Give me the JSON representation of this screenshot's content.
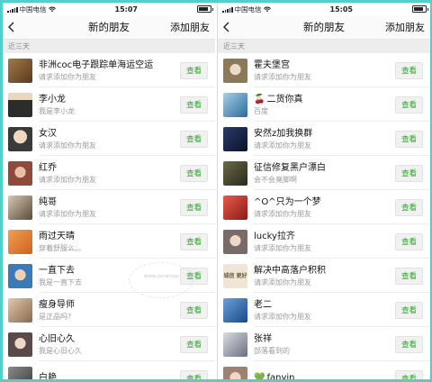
{
  "left": {
    "status": {
      "carrier": "中国电信",
      "time": "15:07"
    },
    "nav": {
      "title": "新的朋友",
      "action": "添加朋友"
    },
    "section": "近三天",
    "rows": [
      {
        "name": "非洲coc电子跟踪单海运空运",
        "msg": "请求添加你为朋友",
        "button": "查看",
        "color": "#7a5a3a"
      },
      {
        "name": "李小龙",
        "msg": "我是李小龙",
        "button": "查看",
        "color": "#2c2c2c"
      },
      {
        "name": "女汉",
        "msg": "请求添加你为朋友",
        "button": "查看",
        "color": "#c9b7a5"
      },
      {
        "name": "红乔",
        "msg": "请求添加你为朋友",
        "button": "查看",
        "color": "#8e5a4a"
      },
      {
        "name": "纯哥",
        "msg": "请求添加你为朋友",
        "button": "查看",
        "color": "#5a4a3a"
      },
      {
        "name": "雨过天晴",
        "msg": "穿着舒服么。。",
        "button": "查看",
        "color": "#e07830"
      },
      {
        "name": "一直下去",
        "msg": "我是一直下去",
        "button": "查看",
        "color": "#3a7ab8"
      },
      {
        "name": "瘦身导师",
        "msg": "是正品吗?",
        "button": "查看",
        "color": "#b89a7a"
      },
      {
        "name": "心旧心久",
        "msg": "我是心旧心久",
        "button": "查看",
        "color": "#a58a8a"
      },
      {
        "name": "白艳",
        "msg": "",
        "button": "查看",
        "color": "#6a6a6a"
      }
    ],
    "watermark": "www.zzcw.top"
  },
  "right": {
    "status": {
      "carrier": "中国电信",
      "time": "15:05"
    },
    "nav": {
      "title": "新的朋友",
      "action": "添加朋友"
    },
    "section": "近三天",
    "rows": [
      {
        "name": "霍夫堡宫",
        "msg": "请求添加你为朋友",
        "button": "查看",
        "color": "#8a7a5a"
      },
      {
        "name": "二货你真",
        "msg": "百度",
        "button": "查看",
        "color": "#4a8ab0"
      },
      {
        "name": "安然z加我换群",
        "msg": "请求添加你为朋友",
        "button": "查看",
        "color": "#1a2a4a"
      },
      {
        "name": "征信修复黑户漂白",
        "msg": "会不会臭脚啊",
        "button": "查看",
        "color": "#3a3a2a"
      },
      {
        "name": "^O^只为一个梦",
        "msg": "请求添加你为朋友",
        "button": "查看",
        "color": "#c03a2a"
      },
      {
        "name": "lucky拉齐",
        "msg": "请求添加你为朋友",
        "button": "查看",
        "color": "#7a6a6a"
      },
      {
        "name": "解决中高落户积积",
        "msg": "请求添加你为朋友",
        "button": "查看",
        "color": "#9a8a6a",
        "avatar_text": "城信 更好",
        "avatar_text_color": "#6a5a3a"
      },
      {
        "name": "老二",
        "msg": "请求添加你为朋友",
        "button": "查看",
        "color": "#4a7ab0"
      },
      {
        "name": "张祥",
        "msg": "部落看到的",
        "button": "查看",
        "color": "#9aa0aa"
      },
      {
        "name": "fanyin",
        "msg": "",
        "button": "查看",
        "color": "#c0a090"
      }
    ]
  },
  "colors": {
    "accent_green": "#1aad19",
    "background_teal": "#4fd0c9"
  }
}
